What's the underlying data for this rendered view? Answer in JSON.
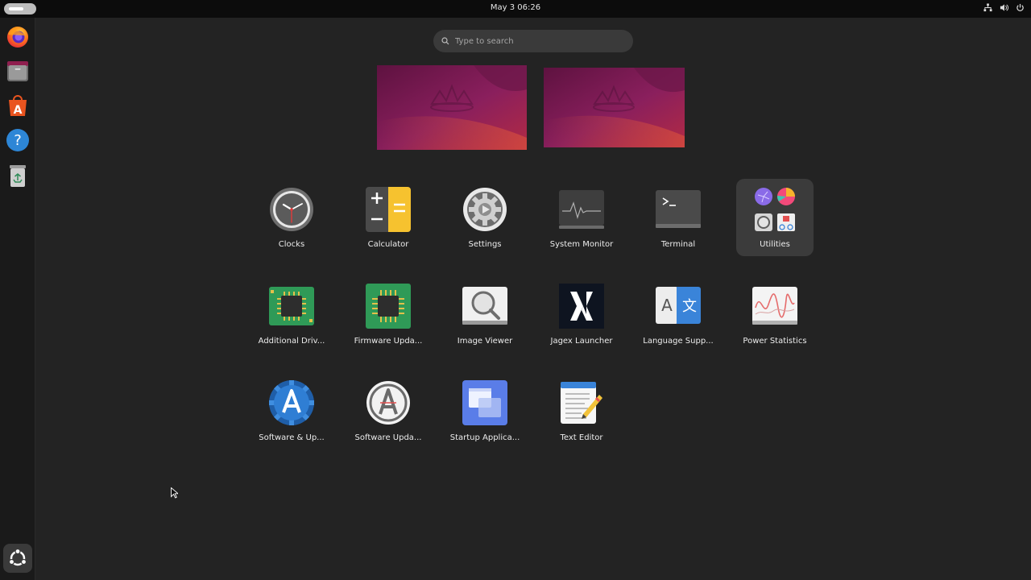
{
  "topbar": {
    "clock": "May 3  06:26",
    "tray_icons": [
      "network-icon",
      "volume-icon",
      "power-icon"
    ]
  },
  "dock": {
    "items": [
      {
        "name": "Firefox",
        "icon": "firefox-icon"
      },
      {
        "name": "Files",
        "icon": "files-icon"
      },
      {
        "name": "App Center",
        "icon": "app-center-icon"
      },
      {
        "name": "Help",
        "icon": "help-icon"
      },
      {
        "name": "Trash",
        "icon": "trash-icon"
      }
    ],
    "show_apps_icon": "ubuntu-logo-icon"
  },
  "search": {
    "placeholder": "Type to search"
  },
  "workspaces": [
    "workspace-1",
    "workspace-2"
  ],
  "apps": [
    {
      "label": "Clocks",
      "icon": "clocks-icon"
    },
    {
      "label": "Calculator",
      "icon": "calculator-icon"
    },
    {
      "label": "Settings",
      "icon": "settings-icon"
    },
    {
      "label": "System Monitor",
      "icon": "system-monitor-icon"
    },
    {
      "label": "Terminal",
      "icon": "terminal-icon"
    },
    {
      "label": "Utilities",
      "icon": "utilities-folder-icon"
    },
    {
      "label": "Additional Driv...",
      "icon": "chip-icon"
    },
    {
      "label": "Firmware Upda...",
      "icon": "chip-icon"
    },
    {
      "label": "Image Viewer",
      "icon": "image-viewer-icon"
    },
    {
      "label": "Jagex Launcher",
      "icon": "jagex-icon"
    },
    {
      "label": "Language Supp...",
      "icon": "language-icon"
    },
    {
      "label": "Power Statistics",
      "icon": "power-statistics-icon"
    },
    {
      "label": "Software & Up...",
      "icon": "software-sources-icon"
    },
    {
      "label": "Software Upda...",
      "icon": "software-updater-icon"
    },
    {
      "label": "Startup Applica...",
      "icon": "startup-apps-icon"
    },
    {
      "label": "Text Editor",
      "icon": "text-editor-icon"
    }
  ],
  "colors": {
    "background": "#232323",
    "topbar": "#0c0c0c",
    "dock": "#1a1a1a",
    "folder_highlight": "#3b3b3b",
    "wallpaper_purple": "#7a1d5c",
    "wallpaper_orange": "#c8403a"
  }
}
